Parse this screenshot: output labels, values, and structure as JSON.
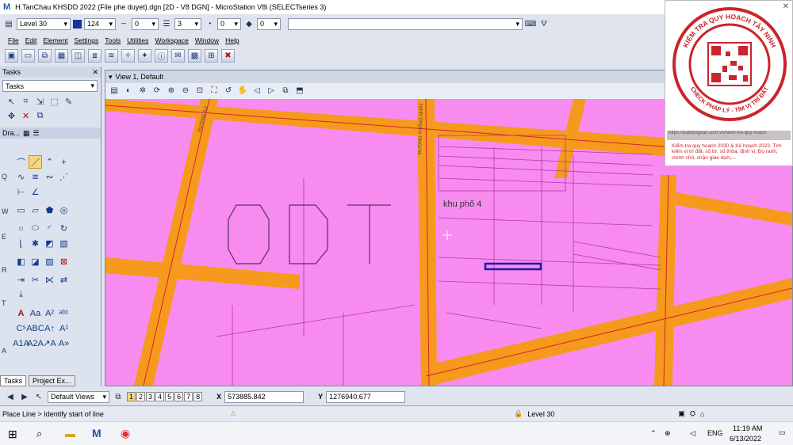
{
  "window": {
    "title": "H.TanChau KHSDD 2022 (File phe duyet).dgn [2D - V8 DGN] - MicroStation V8i (SELECTseries 3)"
  },
  "attributes": {
    "level": "Level 30",
    "color": "124",
    "style": "0",
    "weight": "3",
    "transparency": "0",
    "priority": "0"
  },
  "menu": [
    "File",
    "Edit",
    "Element",
    "Settings",
    "Tools",
    "Utilities",
    "Workspace",
    "Window",
    "Help"
  ],
  "tasks": {
    "title": "Tasks",
    "combo": "Tasks",
    "drawing_label": "Dra...",
    "letters": [
      "Q",
      "W",
      "E",
      "R",
      "T",
      "A"
    ],
    "tabs": [
      "Tasks",
      "Project Ex..."
    ]
  },
  "view": {
    "title": "View 1, Default"
  },
  "map": {
    "big_label": "ODT",
    "area_label": "khu phố 4",
    "road_labels": [
      "ĐƯỜNG 3-2",
      "ĐƯỜNG THỐNG NHẤT"
    ]
  },
  "bottom": {
    "views_combo": "Default Views",
    "view_numbers": [
      "1",
      "2",
      "3",
      "4",
      "5",
      "6",
      "7",
      "8"
    ],
    "x_label": "X",
    "x_value": "573885.842",
    "y_label": "Y",
    "y_value": "1276940.677"
  },
  "status": {
    "prompt": "Place Line > Identify start of line",
    "level": "Level 30"
  },
  "taskbar": {
    "time": "11:19 AM",
    "date": "6/13/2022",
    "lang": "ENG"
  },
  "overlay": {
    "stamp_top": "KIỂM TRA QUY HOẠCH TÂY NINH",
    "stamp_bottom": "CHECK PHÁP LÝ - TÌM VỊ TRÍ ĐẤT",
    "url_text": "https://batdongsan.com.vn/kiem-tra-quy-hoach",
    "ad_text": "Kiểm tra quy hoạch 2030 & Kế hoạch 2022. Tìm kiếm vị trí đất, số tờ, số thửa, định vị. Đo ranh, chính chủ, chặn giao dịch,..."
  },
  "colors": {
    "pink": "#f78bf0",
    "road": "#f59a1c",
    "redline": "#d8242a",
    "blueSel": "#1a1aa8"
  }
}
